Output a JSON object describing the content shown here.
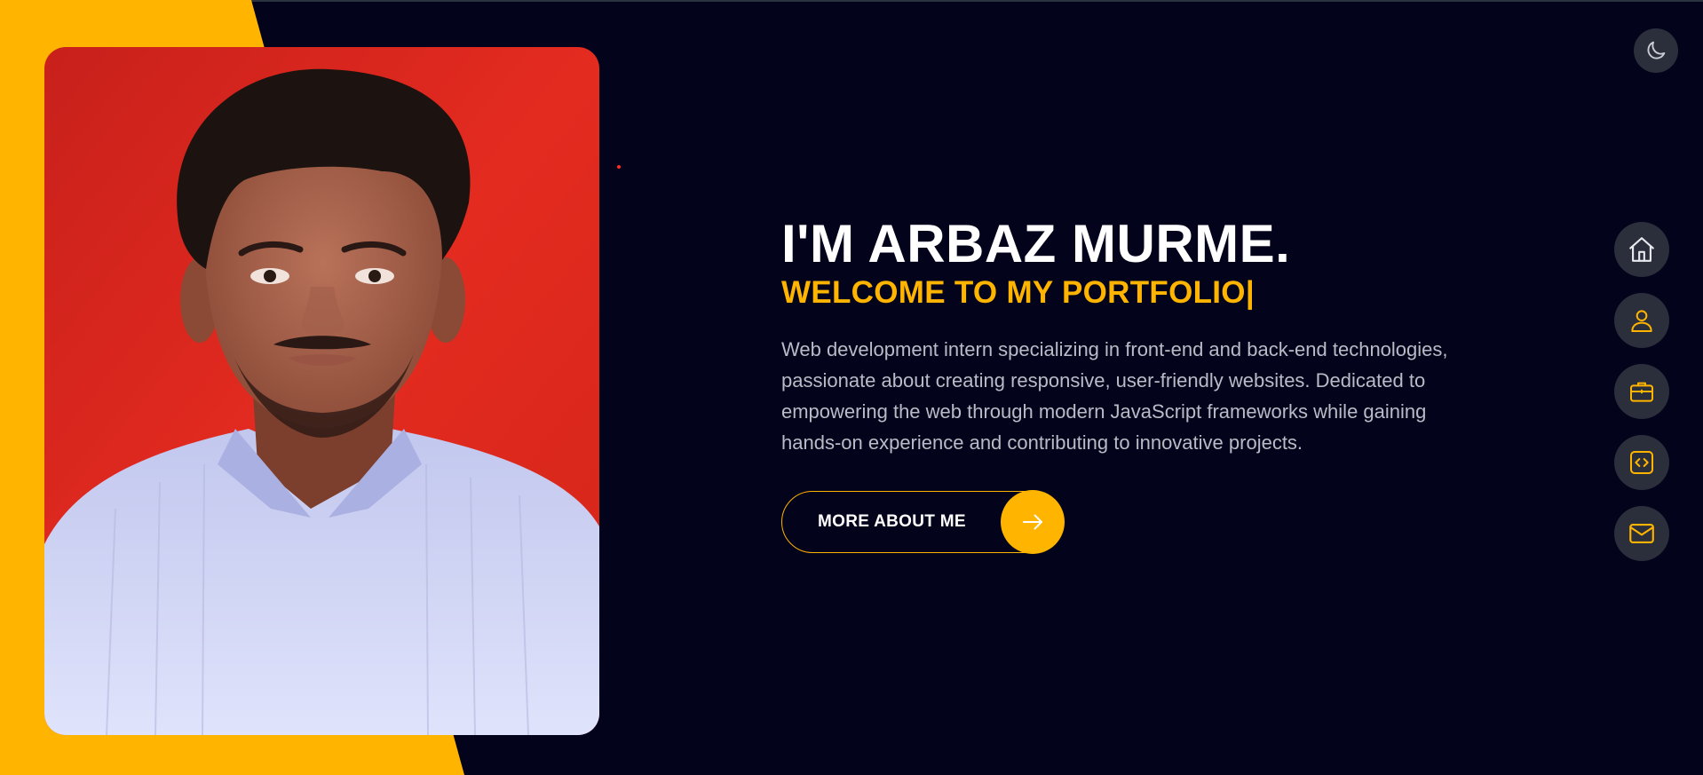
{
  "hero": {
    "title": "I'M ARBAZ MURME.",
    "subtitle": "WELCOME TO MY PORTFOLIO|",
    "description": "Web development intern specializing in front-end and back-end technologies, passionate about creating responsive, user-friendly websites. Dedicated to empowering the web through modern JavaScript frameworks while gaining hands-on experience and contributing to innovative projects.",
    "cta_label": "MORE ABOUT ME"
  },
  "icons": {
    "theme_toggle": "moon-icon",
    "cta": "arrow-right-icon",
    "nav": [
      "home-icon",
      "user-icon",
      "briefcase-icon",
      "code-icon",
      "mail-icon"
    ]
  },
  "colors": {
    "background": "#03031c",
    "accent": "#ffb400",
    "photo_background": "#e02a1f",
    "nav_button": "#2b2f3b",
    "text": "#ffffff",
    "muted_text": "#b9bcc6"
  }
}
